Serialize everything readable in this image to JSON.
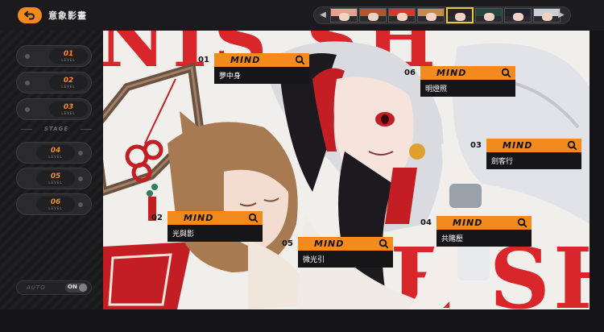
{
  "header": {
    "title": "意象影畫",
    "back_icon": "back-arrow-icon"
  },
  "character_selector": {
    "portraits": [
      {
        "name": "character-1",
        "hair": "#e7a08c",
        "active": false
      },
      {
        "name": "character-2",
        "hair": "#b4552f",
        "active": false
      },
      {
        "name": "character-3",
        "hair": "#d23a2a",
        "active": false
      },
      {
        "name": "character-4",
        "hair": "#c78a4c",
        "active": false
      },
      {
        "name": "character-5",
        "hair": "#2a2228",
        "active": true
      },
      {
        "name": "character-6",
        "hair": "#24483c",
        "active": false
      },
      {
        "name": "character-7",
        "hair": "#1f2230",
        "active": false
      },
      {
        "name": "character-8",
        "hair": "#c9cdd4",
        "active": false
      }
    ]
  },
  "levels": {
    "items": [
      {
        "num": "01",
        "sub": "LEVEL"
      },
      {
        "num": "02",
        "sub": "LEVEL"
      },
      {
        "num": "03",
        "sub": "LEVEL"
      },
      {
        "num": "04",
        "sub": "LEVEL"
      },
      {
        "num": "05",
        "sub": "LEVEL"
      },
      {
        "num": "06",
        "sub": "LEVEL"
      }
    ],
    "stage_label": "STAGE"
  },
  "auto_toggle": {
    "label": "AUTO",
    "state": "ON"
  },
  "background_text": {
    "top": "NIS SH",
    "bottom": "YE SH",
    "quote": "“"
  },
  "minds": [
    {
      "index": "01",
      "word": "MIND",
      "name": "夢中身"
    },
    {
      "index": "06",
      "word": "MIND",
      "name": "明燈照"
    },
    {
      "index": "03",
      "word": "MIND",
      "name": "劍客行"
    },
    {
      "index": "02",
      "word": "MIND",
      "name": "光與影"
    },
    {
      "index": "04",
      "word": "MIND",
      "name": "共賭壓"
    },
    {
      "index": "05",
      "word": "MIND",
      "name": "微光引"
    }
  ],
  "colors": {
    "accent": "#f28a1e",
    "poster_red": "#d9262a",
    "hair_silver": "#d9dbe0",
    "hair_black": "#1c1a1f",
    "hair_red": "#c41e25"
  }
}
